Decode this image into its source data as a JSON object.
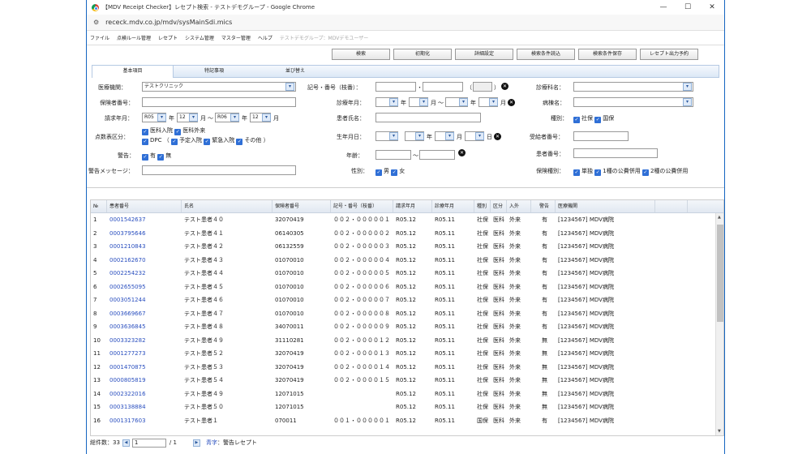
{
  "window": {
    "title": "【MDV Receipt Checker】レセプト検索 - テストデモグループ - Google Chrome",
    "min_icon": "minimize-icon",
    "max_icon": "maximize-icon",
    "close_icon": "close-icon",
    "min_glyph": "—",
    "max_glyph": "☐",
    "close_glyph": "✕"
  },
  "address": {
    "tune_glyph": "⚙",
    "url": "receck.mdv.co.jp/mdv/sysMainSdi.mics"
  },
  "menu": [
    "ファイル",
    "点検ルール管理",
    "レセプト",
    "システム管理",
    "マスター管理",
    "ヘルプ"
  ],
  "menu_disabled": "テストデモグループ：MDVデモユーザー",
  "toolbar": [
    "検索",
    "初期化",
    "詳細設定",
    "検索条件読込",
    "検索条件保存",
    "レセプト出力予約"
  ],
  "tabs": [
    "基本項目",
    "特記事項",
    "並び替え"
  ],
  "form": {
    "institution_label": "医療機関：",
    "institution_value": "テストクリニック",
    "insurer_label": "保険者番号：",
    "billing_label": "請求年月：",
    "billing_from": "R05",
    "billing_from_month": "12",
    "billing_to": "R06",
    "billing_to_month": "12",
    "year_char": "年",
    "month_char": "月",
    "day_char": "日",
    "tilde": "～",
    "score_label": "点数表区分：",
    "score_opt1": "医科入院",
    "score_opt2": "医科外来",
    "score_opt3": "DPC",
    "score_paren_open": "（",
    "score_opt4": "予定入院",
    "score_opt5": "緊急入院",
    "score_opt6": "その他",
    "score_paren_close": "）",
    "warning_label": "警告：",
    "warning_yes": "有",
    "warning_no": "無",
    "warning_msg_label": "警告メッセージ：",
    "symbol_label": "記号・番号（枝番）：",
    "symbol_dot": "・",
    "symbol_paren_open": "（",
    "symbol_paren_close": "）",
    "treatment_label": "診療年月：",
    "patient_name_label": "患者氏名：",
    "birth_label": "生年月日：",
    "age_label": "年齢：",
    "sex_label": "性別：",
    "sex_male": "男",
    "sex_female": "女",
    "dept_label": "診療科名：",
    "disease_label": "病棟名：",
    "type_label": "種別：",
    "type_social": "社保",
    "type_national": "国保",
    "recipient_label": "受給者番号：",
    "patient_no_label": "患者番号：",
    "ins_type_label": "保険種別：",
    "ins_single": "単独",
    "ins_pub1": "1種の公費併用",
    "ins_pub2": "2種の公費併用",
    "check_glyph": "✓",
    "dd_glyph": "▾",
    "clear_glyph": "✕"
  },
  "grid": {
    "headers": [
      "№",
      "患者番号",
      "氏名",
      "保険者番号",
      "記号・番号（枝番）",
      "請求年月",
      "診療年月",
      "種別",
      "区分",
      "入外",
      "警告",
      "医療機関"
    ],
    "rows": [
      [
        "1",
        "0001542637",
        "テスト患者４０",
        "32070419",
        "００２・０００００１",
        "R05.12",
        "R05.11",
        "社保",
        "医科",
        "外来",
        "有",
        "[1234567] MDV病院"
      ],
      [
        "2",
        "0003795646",
        "テスト患者４１",
        "06140305",
        "００２・０００００２",
        "R05.12",
        "R05.11",
        "社保",
        "医科",
        "外来",
        "有",
        "[1234567] MDV病院"
      ],
      [
        "3",
        "0001210843",
        "テスト患者４２",
        "06132559",
        "００２・０００００３",
        "R05.12",
        "R05.11",
        "社保",
        "医科",
        "外来",
        "有",
        "[1234567] MDV病院"
      ],
      [
        "4",
        "0002162670",
        "テスト患者４３",
        "01070010",
        "００２・０００００４",
        "R05.12",
        "R05.11",
        "社保",
        "医科",
        "外来",
        "有",
        "[1234567] MDV病院"
      ],
      [
        "5",
        "0002254232",
        "テスト患者４４",
        "01070010",
        "００２・０００００５",
        "R05.12",
        "R05.11",
        "社保",
        "医科",
        "外来",
        "有",
        "[1234567] MDV病院"
      ],
      [
        "6",
        "0002655095",
        "テスト患者４５",
        "01070010",
        "００２・０００００６",
        "R05.12",
        "R05.11",
        "社保",
        "医科",
        "外来",
        "有",
        "[1234567] MDV病院"
      ],
      [
        "7",
        "0003051244",
        "テスト患者４６",
        "01070010",
        "００２・０００００７",
        "R05.12",
        "R05.11",
        "社保",
        "医科",
        "外来",
        "有",
        "[1234567] MDV病院"
      ],
      [
        "8",
        "0003669667",
        "テスト患者４７",
        "01070010",
        "００２・０００００８",
        "R05.12",
        "R05.11",
        "社保",
        "医科",
        "外来",
        "有",
        "[1234567] MDV病院"
      ],
      [
        "9",
        "0003636845",
        "テスト患者４８",
        "34070011",
        "００２・０００００９",
        "R05.12",
        "R05.11",
        "社保",
        "医科",
        "外来",
        "有",
        "[1234567] MDV病院"
      ],
      [
        "10",
        "0003323282",
        "テスト患者４９",
        "31110281",
        "００２・００００１２",
        "R05.12",
        "R05.11",
        "社保",
        "医科",
        "外来",
        "無",
        "[1234567] MDV病院"
      ],
      [
        "11",
        "0001277273",
        "テスト患者５２",
        "32070419",
        "００２・００００１３",
        "R05.12",
        "R05.11",
        "社保",
        "医科",
        "外来",
        "無",
        "[1234567] MDV病院"
      ],
      [
        "12",
        "0001470875",
        "テスト患者５３",
        "32070419",
        "００２・００００１４",
        "R05.12",
        "R05.11",
        "社保",
        "医科",
        "外来",
        "無",
        "[1234567] MDV病院"
      ],
      [
        "13",
        "0000805819",
        "テスト患者５４",
        "32070419",
        "００２・００００１５",
        "R05.12",
        "R05.11",
        "社保",
        "医科",
        "外来",
        "無",
        "[1234567] MDV病院"
      ],
      [
        "14",
        "0002322016",
        "テスト患者４９",
        "12071015",
        "",
        "R05.12",
        "R05.11",
        "社保",
        "医科",
        "外来",
        "無",
        "[1234567] MDV病院"
      ],
      [
        "15",
        "0003138884",
        "テスト患者５０",
        "12071015",
        "",
        "R05.12",
        "R05.11",
        "社保",
        "医科",
        "外来",
        "無",
        "[1234567] MDV病院"
      ],
      [
        "16",
        "0001317603",
        "テスト患者１",
        "070011",
        "００１・０００００１",
        "R05.12",
        "R05.11",
        "国保",
        "医科",
        "外来",
        "有",
        "[1234567] MDV病院"
      ]
    ]
  },
  "footer": {
    "total_label": "総件数：33",
    "page_value": "1",
    "page_total": "/ 1",
    "legend_blue": "青字",
    "legend_text": "：警告レセプト"
  }
}
